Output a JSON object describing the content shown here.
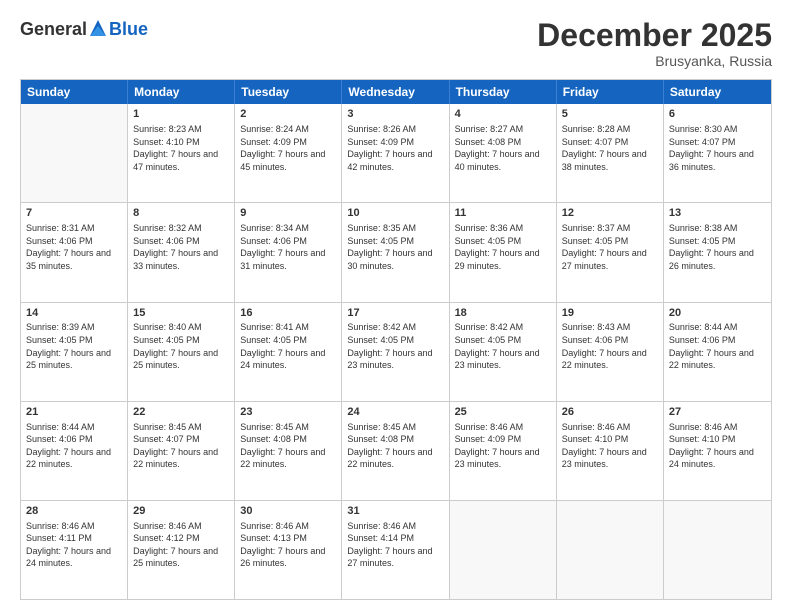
{
  "header": {
    "logo_general": "General",
    "logo_blue": "Blue",
    "month_title": "December 2025",
    "location": "Brusyanka, Russia"
  },
  "weekdays": [
    "Sunday",
    "Monday",
    "Tuesday",
    "Wednesday",
    "Thursday",
    "Friday",
    "Saturday"
  ],
  "rows": [
    [
      {
        "day": "",
        "sunrise": "",
        "sunset": "",
        "daylight": ""
      },
      {
        "day": "1",
        "sunrise": "Sunrise: 8:23 AM",
        "sunset": "Sunset: 4:10 PM",
        "daylight": "Daylight: 7 hours and 47 minutes."
      },
      {
        "day": "2",
        "sunrise": "Sunrise: 8:24 AM",
        "sunset": "Sunset: 4:09 PM",
        "daylight": "Daylight: 7 hours and 45 minutes."
      },
      {
        "day": "3",
        "sunrise": "Sunrise: 8:26 AM",
        "sunset": "Sunset: 4:09 PM",
        "daylight": "Daylight: 7 hours and 42 minutes."
      },
      {
        "day": "4",
        "sunrise": "Sunrise: 8:27 AM",
        "sunset": "Sunset: 4:08 PM",
        "daylight": "Daylight: 7 hours and 40 minutes."
      },
      {
        "day": "5",
        "sunrise": "Sunrise: 8:28 AM",
        "sunset": "Sunset: 4:07 PM",
        "daylight": "Daylight: 7 hours and 38 minutes."
      },
      {
        "day": "6",
        "sunrise": "Sunrise: 8:30 AM",
        "sunset": "Sunset: 4:07 PM",
        "daylight": "Daylight: 7 hours and 36 minutes."
      }
    ],
    [
      {
        "day": "7",
        "sunrise": "Sunrise: 8:31 AM",
        "sunset": "Sunset: 4:06 PM",
        "daylight": "Daylight: 7 hours and 35 minutes."
      },
      {
        "day": "8",
        "sunrise": "Sunrise: 8:32 AM",
        "sunset": "Sunset: 4:06 PM",
        "daylight": "Daylight: 7 hours and 33 minutes."
      },
      {
        "day": "9",
        "sunrise": "Sunrise: 8:34 AM",
        "sunset": "Sunset: 4:06 PM",
        "daylight": "Daylight: 7 hours and 31 minutes."
      },
      {
        "day": "10",
        "sunrise": "Sunrise: 8:35 AM",
        "sunset": "Sunset: 4:05 PM",
        "daylight": "Daylight: 7 hours and 30 minutes."
      },
      {
        "day": "11",
        "sunrise": "Sunrise: 8:36 AM",
        "sunset": "Sunset: 4:05 PM",
        "daylight": "Daylight: 7 hours and 29 minutes."
      },
      {
        "day": "12",
        "sunrise": "Sunrise: 8:37 AM",
        "sunset": "Sunset: 4:05 PM",
        "daylight": "Daylight: 7 hours and 27 minutes."
      },
      {
        "day": "13",
        "sunrise": "Sunrise: 8:38 AM",
        "sunset": "Sunset: 4:05 PM",
        "daylight": "Daylight: 7 hours and 26 minutes."
      }
    ],
    [
      {
        "day": "14",
        "sunrise": "Sunrise: 8:39 AM",
        "sunset": "Sunset: 4:05 PM",
        "daylight": "Daylight: 7 hours and 25 minutes."
      },
      {
        "day": "15",
        "sunrise": "Sunrise: 8:40 AM",
        "sunset": "Sunset: 4:05 PM",
        "daylight": "Daylight: 7 hours and 25 minutes."
      },
      {
        "day": "16",
        "sunrise": "Sunrise: 8:41 AM",
        "sunset": "Sunset: 4:05 PM",
        "daylight": "Daylight: 7 hours and 24 minutes."
      },
      {
        "day": "17",
        "sunrise": "Sunrise: 8:42 AM",
        "sunset": "Sunset: 4:05 PM",
        "daylight": "Daylight: 7 hours and 23 minutes."
      },
      {
        "day": "18",
        "sunrise": "Sunrise: 8:42 AM",
        "sunset": "Sunset: 4:05 PM",
        "daylight": "Daylight: 7 hours and 23 minutes."
      },
      {
        "day": "19",
        "sunrise": "Sunrise: 8:43 AM",
        "sunset": "Sunset: 4:06 PM",
        "daylight": "Daylight: 7 hours and 22 minutes."
      },
      {
        "day": "20",
        "sunrise": "Sunrise: 8:44 AM",
        "sunset": "Sunset: 4:06 PM",
        "daylight": "Daylight: 7 hours and 22 minutes."
      }
    ],
    [
      {
        "day": "21",
        "sunrise": "Sunrise: 8:44 AM",
        "sunset": "Sunset: 4:06 PM",
        "daylight": "Daylight: 7 hours and 22 minutes."
      },
      {
        "day": "22",
        "sunrise": "Sunrise: 8:45 AM",
        "sunset": "Sunset: 4:07 PM",
        "daylight": "Daylight: 7 hours and 22 minutes."
      },
      {
        "day": "23",
        "sunrise": "Sunrise: 8:45 AM",
        "sunset": "Sunset: 4:08 PM",
        "daylight": "Daylight: 7 hours and 22 minutes."
      },
      {
        "day": "24",
        "sunrise": "Sunrise: 8:45 AM",
        "sunset": "Sunset: 4:08 PM",
        "daylight": "Daylight: 7 hours and 22 minutes."
      },
      {
        "day": "25",
        "sunrise": "Sunrise: 8:46 AM",
        "sunset": "Sunset: 4:09 PM",
        "daylight": "Daylight: 7 hours and 23 minutes."
      },
      {
        "day": "26",
        "sunrise": "Sunrise: 8:46 AM",
        "sunset": "Sunset: 4:10 PM",
        "daylight": "Daylight: 7 hours and 23 minutes."
      },
      {
        "day": "27",
        "sunrise": "Sunrise: 8:46 AM",
        "sunset": "Sunset: 4:10 PM",
        "daylight": "Daylight: 7 hours and 24 minutes."
      }
    ],
    [
      {
        "day": "28",
        "sunrise": "Sunrise: 8:46 AM",
        "sunset": "Sunset: 4:11 PM",
        "daylight": "Daylight: 7 hours and 24 minutes."
      },
      {
        "day": "29",
        "sunrise": "Sunrise: 8:46 AM",
        "sunset": "Sunset: 4:12 PM",
        "daylight": "Daylight: 7 hours and 25 minutes."
      },
      {
        "day": "30",
        "sunrise": "Sunrise: 8:46 AM",
        "sunset": "Sunset: 4:13 PM",
        "daylight": "Daylight: 7 hours and 26 minutes."
      },
      {
        "day": "31",
        "sunrise": "Sunrise: 8:46 AM",
        "sunset": "Sunset: 4:14 PM",
        "daylight": "Daylight: 7 hours and 27 minutes."
      },
      {
        "day": "",
        "sunrise": "",
        "sunset": "",
        "daylight": ""
      },
      {
        "day": "",
        "sunrise": "",
        "sunset": "",
        "daylight": ""
      },
      {
        "day": "",
        "sunrise": "",
        "sunset": "",
        "daylight": ""
      }
    ]
  ]
}
